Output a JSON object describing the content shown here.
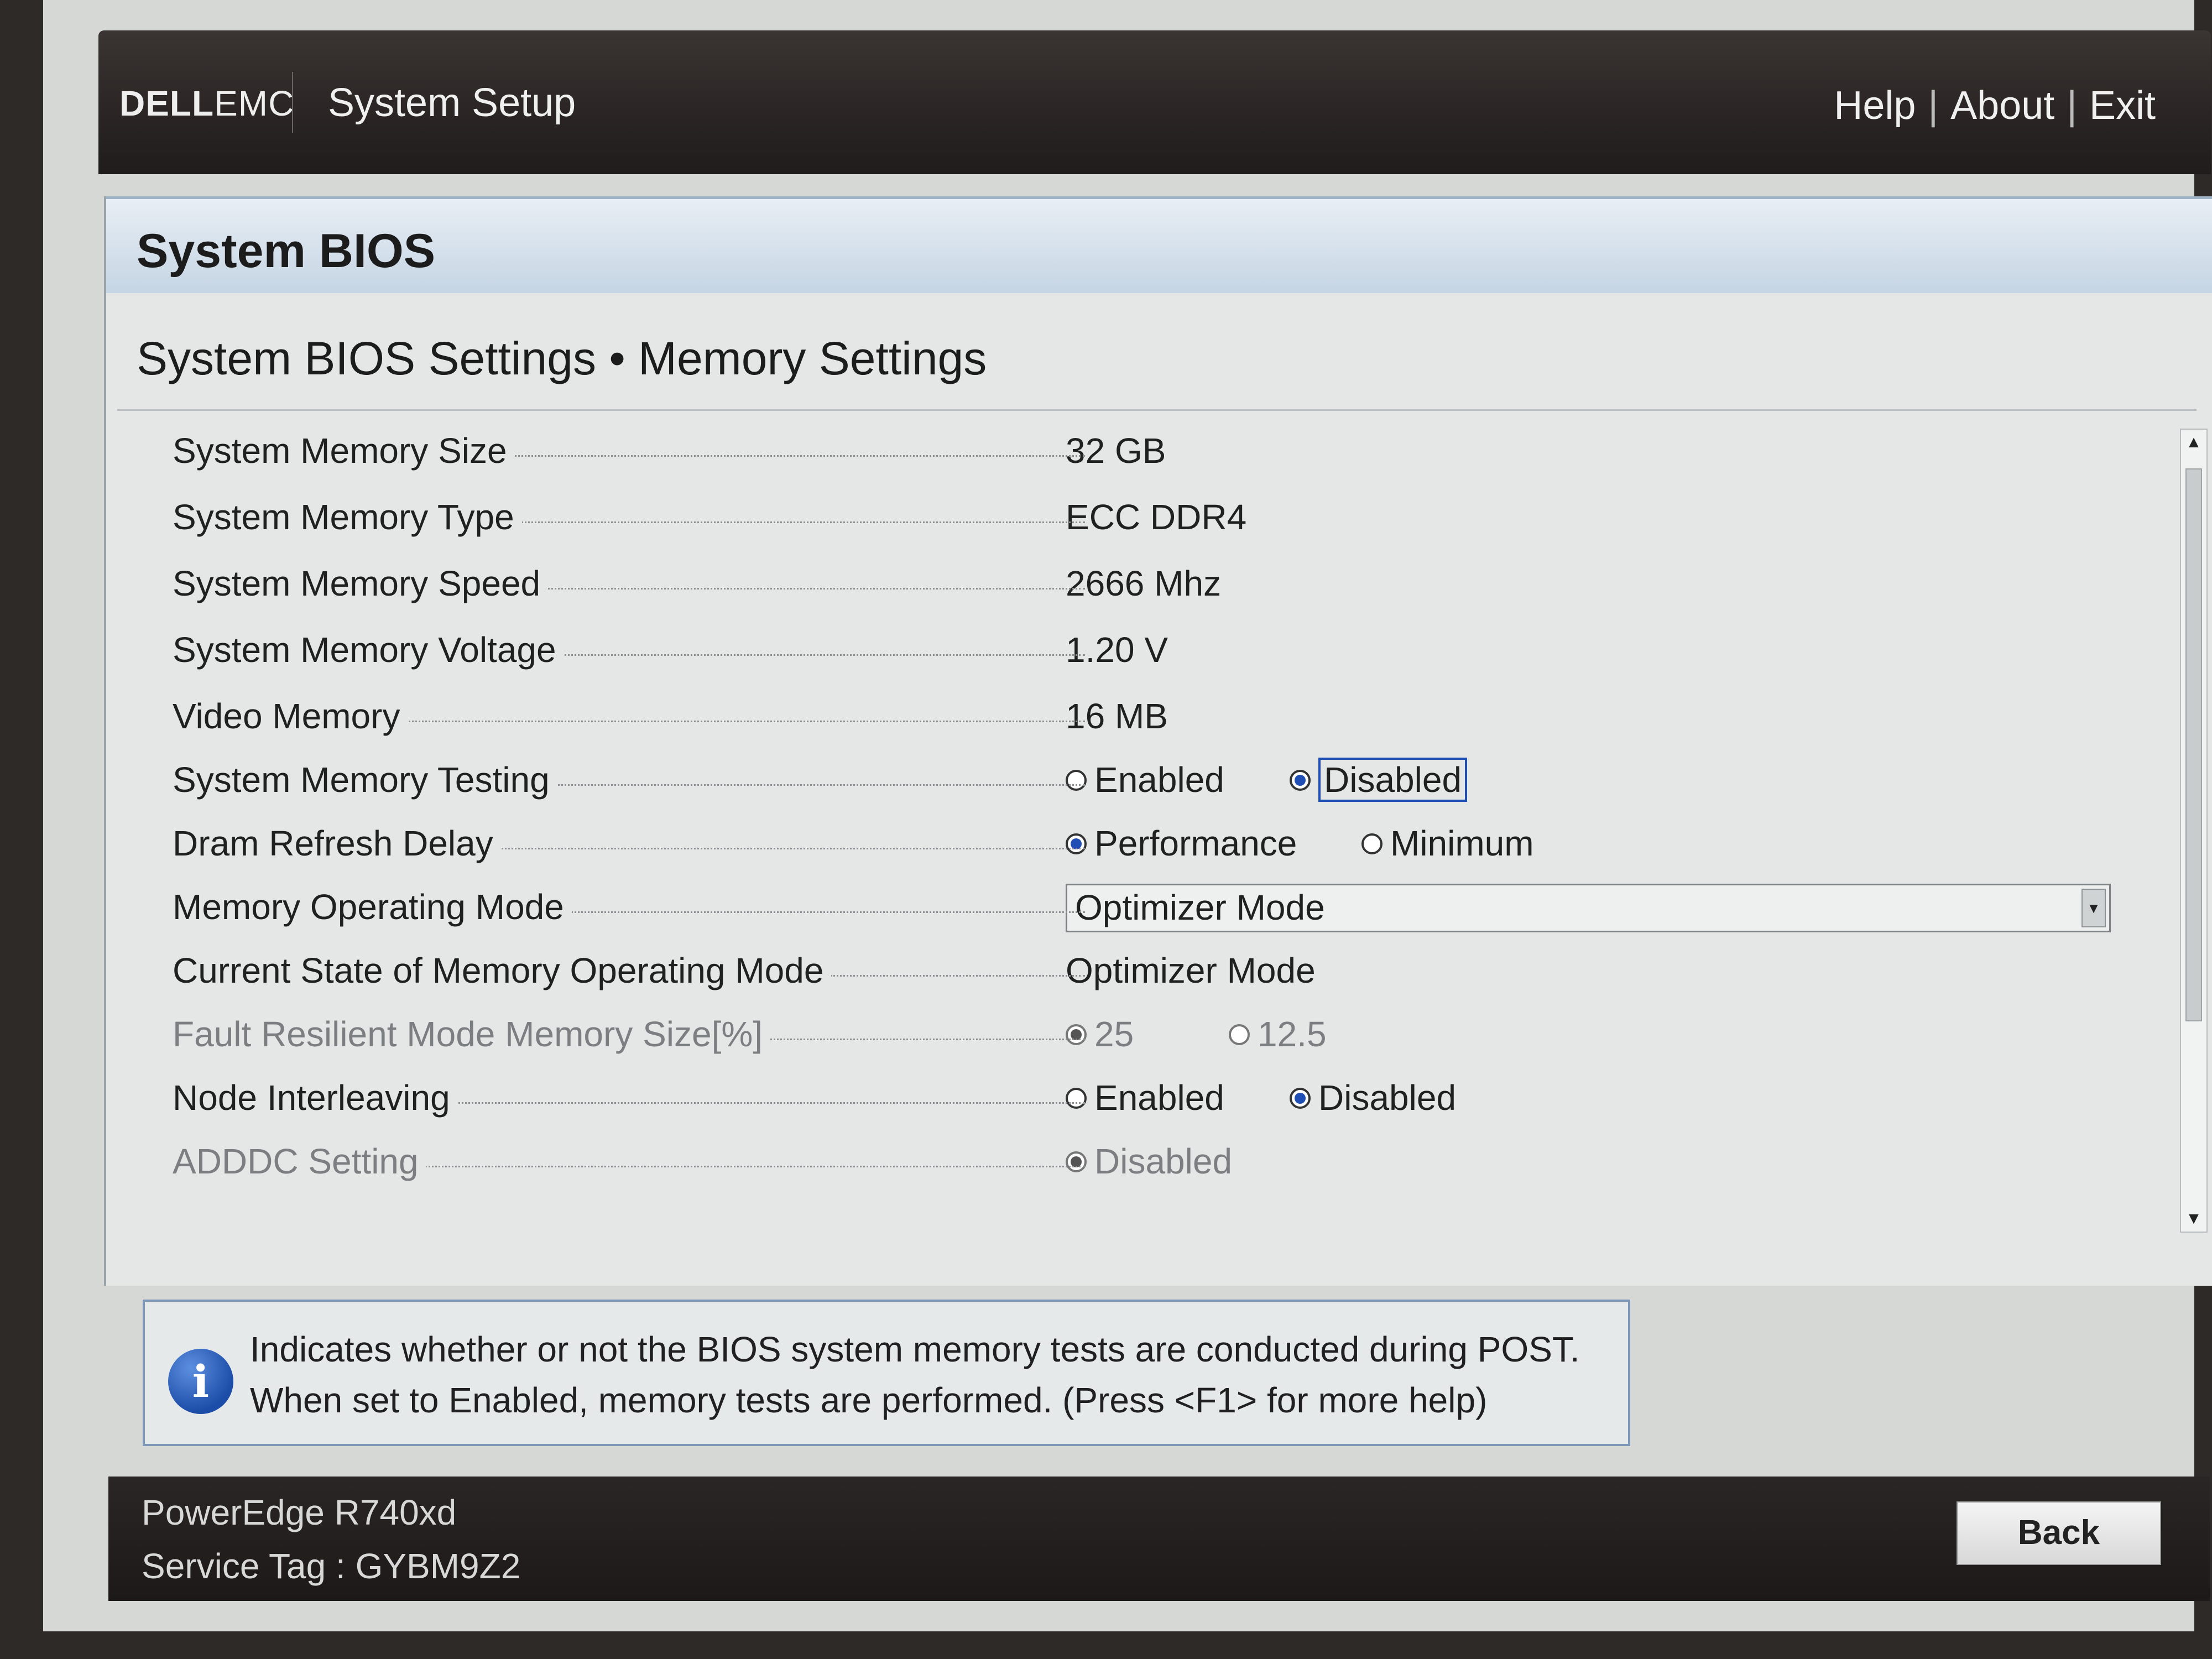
{
  "header": {
    "logo_bold": "DELL",
    "logo_thin": "EMC",
    "app_title": "System Setup",
    "links": [
      "Help",
      "About",
      "Exit"
    ],
    "separator": "|"
  },
  "panel": {
    "title": "System BIOS",
    "heading": "System BIOS Settings • Memory Settings"
  },
  "settings": [
    {
      "label": "System Memory Size",
      "value": "32 GB"
    },
    {
      "label": "System Memory Type",
      "value": "ECC DDR4"
    },
    {
      "label": "System Memory Speed",
      "value": "2666 Mhz"
    },
    {
      "label": "System Memory Voltage",
      "value": "1.20 V"
    },
    {
      "label": "Video Memory",
      "value": "16 MB"
    },
    {
      "label": "System Memory Testing",
      "options": [
        "Enabled",
        "Disabled"
      ],
      "selected": "Disabled"
    },
    {
      "label": "Dram Refresh Delay",
      "options": [
        "Performance",
        "Minimum"
      ],
      "selected": "Performance"
    },
    {
      "label": "Memory Operating Mode",
      "select_value": "Optimizer Mode"
    },
    {
      "label": "Current State of Memory Operating Mode",
      "value": "Optimizer Mode"
    },
    {
      "label": "Fault Resilient Mode Memory Size[%]",
      "options": [
        "25",
        "12.5"
      ],
      "selected": "25",
      "disabled": true
    },
    {
      "label": "Node Interleaving",
      "options": [
        "Enabled",
        "Disabled"
      ],
      "selected": "Disabled"
    },
    {
      "label": "ADDDC Setting",
      "options": [
        "Disabled"
      ],
      "selected": "Disabled",
      "disabled": true
    }
  ],
  "help": {
    "line1": "Indicates whether or not the BIOS system memory tests are conducted during POST.",
    "line2": "When set to Enabled, memory tests are performed. (Press <F1> for more help)"
  },
  "footer": {
    "model": "PowerEdge R740xd",
    "service_tag": "Service Tag : GYBM9Z2",
    "back_label": "Back"
  },
  "icons": {
    "info": "info-icon",
    "scroll_up": "arrow-up-icon",
    "scroll_down": "arrow-down-icon",
    "dropdown": "chevron-down-icon"
  },
  "colors": {
    "accent": "#1f4fb5",
    "header_bg": "#2a2524",
    "panel_header": "#c5d5e4"
  }
}
